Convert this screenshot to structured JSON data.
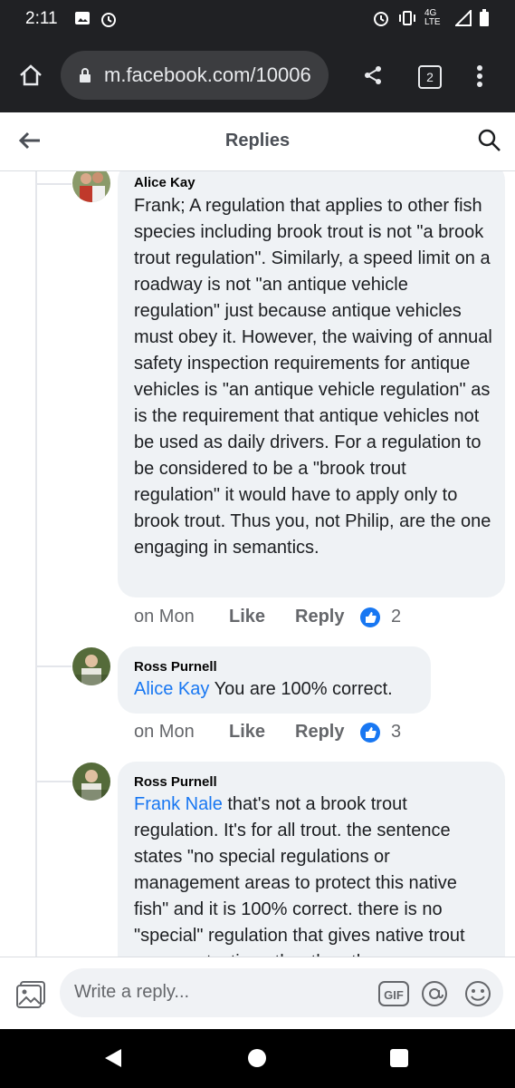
{
  "status_bar": {
    "time": "2:11",
    "network": "4G LTE"
  },
  "browser": {
    "url": "m.facebook.com/10006",
    "tab_count": "2"
  },
  "header": {
    "title": "Replies"
  },
  "comments": [
    {
      "author": "Alice Kay",
      "mention": "",
      "text": "Frank;  A regulation that applies to other fish species including brook trout is not \"a brook trout regulation\".  Similarly, a speed limit on a roadway is not \"an antique vehicle regulation\" just because antique vehicles must obey it.  However, the waiving of annual safety inspection requirements for antique vehicles is \"an antique vehicle regulation\" as is the requirement that antique vehicles not be used as daily drivers.  For a regulation to be considered to be a \"brook trout regulation\" it would have to apply only to brook trout.  Thus you, not Philip, are the one engaging in semantics.",
      "time": "on Mon",
      "like_label": "Like",
      "reply_label": "Reply",
      "reactions": "2"
    },
    {
      "author": "Ross Purnell",
      "mention": "Alice Kay",
      "text": " You are 100% correct.",
      "time": "on Mon",
      "like_label": "Like",
      "reply_label": "Reply",
      "reactions": "3"
    },
    {
      "author": "Ross Purnell",
      "mention": "Frank Nale",
      "text": " that's not a brook trout regulation. It's for all trout. the sentence states \"no special regulations or management areas to protect this native fish\" and it is 100% correct. there is no \"special\" regulation that gives native trout more protection other than the",
      "time": "",
      "like_label": "",
      "reply_label": "",
      "reactions": ""
    }
  ],
  "composer": {
    "placeholder": "Write a reply...",
    "gif_label": "GIF"
  },
  "colors": {
    "mention": "#1877f2",
    "bubble": "#eff2f5",
    "like_icon": "#1877f2"
  }
}
